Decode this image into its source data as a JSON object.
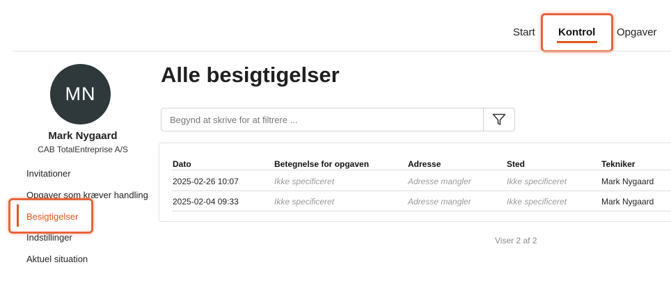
{
  "nav": {
    "items": [
      {
        "label": "Start"
      },
      {
        "label": "Kontrol"
      },
      {
        "label": "Opgaver"
      }
    ],
    "active": "Kontrol"
  },
  "user": {
    "initials": "MN",
    "name": "Mark Nygaard",
    "company": "CAB TotalEntreprise A/S"
  },
  "sidebar": {
    "items": [
      {
        "label": "Invitationer"
      },
      {
        "label": "Opgaver som kræver handling"
      },
      {
        "label": "Besigtigelser"
      },
      {
        "label": "Indstillinger"
      },
      {
        "label": "Aktuel situation"
      }
    ],
    "active": "Besigtigelser"
  },
  "main": {
    "title": "Alle besigtigelser",
    "search_placeholder": "Begynd at skrive for at filtrere ...",
    "filter_icon": "filter-funnel-icon",
    "table": {
      "headers": [
        "Dato",
        "Betegnelse for opgaven",
        "Adresse",
        "Sted",
        "Tekniker"
      ],
      "rows": [
        [
          "2025-02-26 10:07",
          "Ikke specificeret",
          "Adresse mangler",
          "Ikke specificeret",
          "Mark Nygaard"
        ],
        [
          "2025-02-04 09:33",
          "Ikke specificeret",
          "Adresse mangler",
          "Ikke specificeret",
          "Mark Nygaard"
        ]
      ]
    },
    "pager": "Viser 2 af 2"
  },
  "colors": {
    "accent": "#e0561b",
    "highlight": "#e8643a",
    "avatar_bg": "#2f383b"
  }
}
